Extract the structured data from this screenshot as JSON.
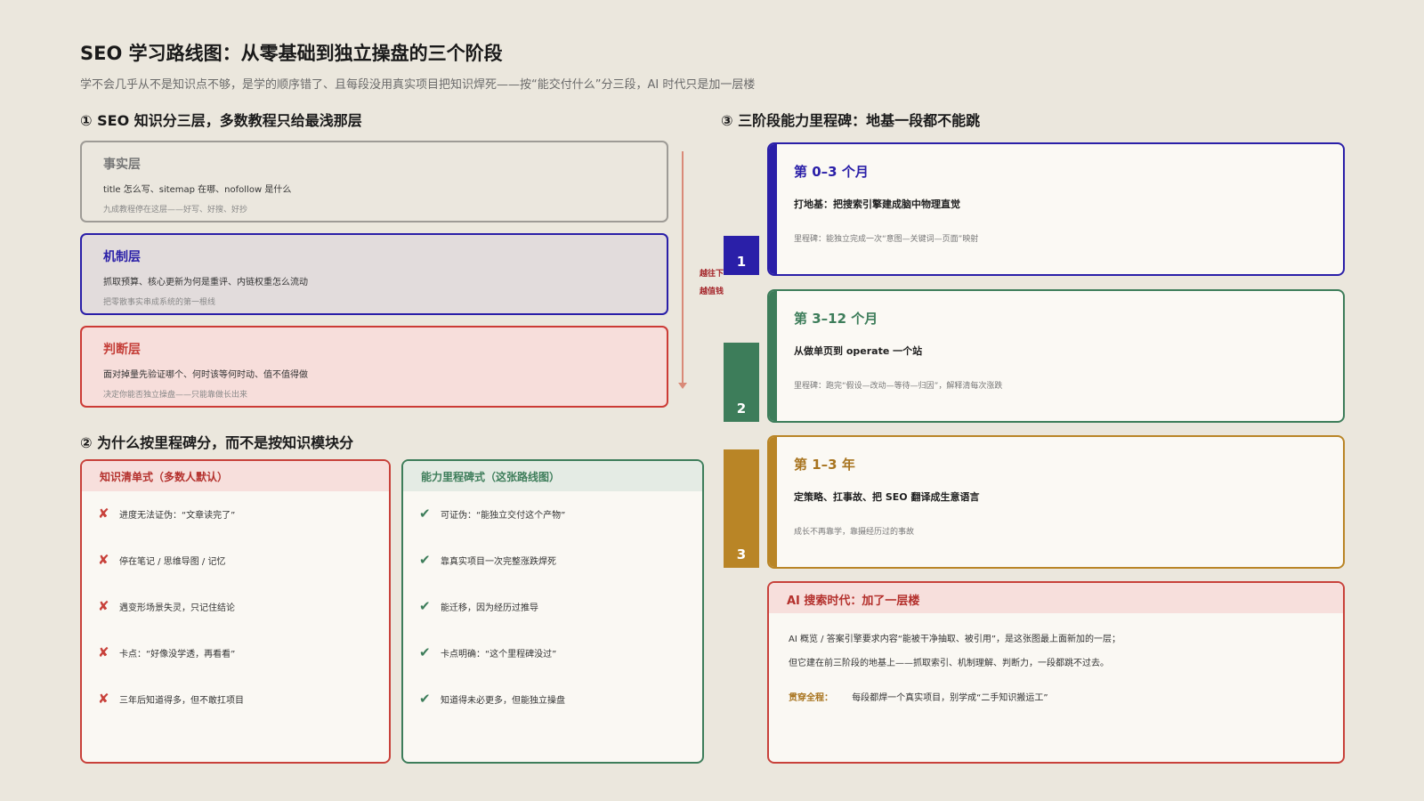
{
  "header": {
    "title": "SEO 学习路线图：从零基础到独立操盘的三个阶段",
    "subtitle": "学不会几乎从不是知识点不够，是学的顺序错了、且每段没用真实项目把知识焊死——按“能交付什么”分三段，AI 时代只是加一层楼"
  },
  "section1": {
    "title": "① SEO 知识分三层，多数教程只给最浅那层",
    "layers": [
      {
        "title": "事实层",
        "desc": "title 怎么写、sitemap 在哪、nofollow 是什么",
        "note": "九成教程停在这层——好写、好搜、好抄"
      },
      {
        "title": "机制层",
        "desc": "抓取预算、核心更新为何是重评、内链权重怎么流动",
        "note": "把零散事实串成系统的第一根线"
      },
      {
        "title": "判断层",
        "desc": "面对掉量先验证哪个、何时该等何时动、值不值得做",
        "note": "决定你能否独立操盘——只能靠做长出来"
      }
    ],
    "depth_labels": [
      "越往下",
      "越值钱"
    ]
  },
  "section2": {
    "title": "② 为什么按里程碑分，而不是按知识模块分",
    "left": {
      "head": "知识清单式（多数人默认）",
      "items": [
        "进度无法证伪：“文章读完了”",
        "停在笔记 / 思维导图 / 记忆",
        "遇变形场景失灵，只记住结论",
        "卡点：“好像没学透，再看看”",
        "三年后知道得多，但不敢扛项目"
      ]
    },
    "right": {
      "head": "能力里程碑式（这张路线图）",
      "items": [
        "可证伪：“能独立交付这个产物”",
        "靠真实项目一次完整涨跌焊死",
        "能迁移，因为经历过推导",
        "卡点明确：“这个里程碑没过”",
        "知道得未必更多，但能独立操盘"
      ]
    },
    "icons": {
      "left": "cross-icon",
      "right": "check-icon"
    }
  },
  "section3": {
    "title": "③ 三阶段能力里程碑：地基一段都不能跳",
    "stages": [
      {
        "num": "1",
        "title": "第 0–3 个月",
        "sub": "打地基：把搜索引擎建成脑中物理直觉",
        "note": "里程碑：能独立完成一次“意图—关键词—页面”映射",
        "color": "#2a1fa8"
      },
      {
        "num": "2",
        "title": "第 3–12 个月",
        "sub": "从做单页到 operate 一个站",
        "note": "里程碑：跑完“假设—改动—等待—归因”，解释清每次涨跌",
        "color": "#3d7d5a"
      },
      {
        "num": "3",
        "title": "第 1–3 年",
        "sub": "定策略、扛事故、把 SEO 翻译成生意语言",
        "note": "成长不再靠学，靠摄经历过的事故",
        "color": "#b98526"
      }
    ],
    "ai": {
      "head": "AI 搜索时代：加了一层楼",
      "line1": "AI 概览 / 答案引擎要求内容“能被干净抽取、被引用”，是这张图最上面新加的一层；",
      "line2": "但它建在前三阶段的地基上——抓取索引、机制理解、判断力，一段都跳不过去。",
      "key": "贯穿全程：",
      "key_text": "每段都焊一个真实项目，别学成“二手知识搬运工”"
    }
  }
}
